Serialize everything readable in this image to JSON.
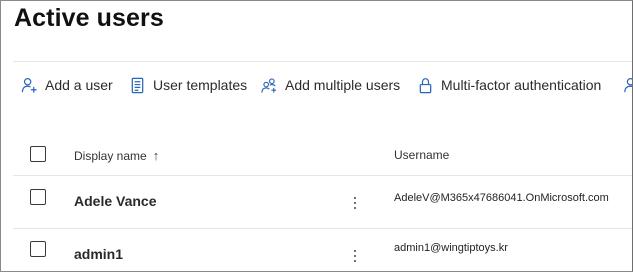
{
  "page": {
    "title": "Active users"
  },
  "toolbar": {
    "items": [
      {
        "label": "Add a user",
        "icon": "add-user-icon"
      },
      {
        "label": "User templates",
        "icon": "template-icon"
      },
      {
        "label": "Add multiple users",
        "icon": "add-multiple-users-icon"
      },
      {
        "label": "Multi-factor authentication",
        "icon": "lock-icon"
      },
      {
        "label": "",
        "icon": "person-icon"
      }
    ]
  },
  "table": {
    "columns": {
      "display_name": "Display name",
      "username": "Username",
      "sort_indicator": "↑"
    },
    "rows": [
      {
        "display_name": "Adele Vance",
        "username": "AdeleV@M365x47686041.OnMicrosoft.com"
      },
      {
        "display_name": "admin1",
        "username": "admin1@wingtiptoys.kr"
      }
    ]
  },
  "colors": {
    "text": "#242424",
    "icon_stroke": "#1f5ea8",
    "divider": "#e6e6e6"
  }
}
